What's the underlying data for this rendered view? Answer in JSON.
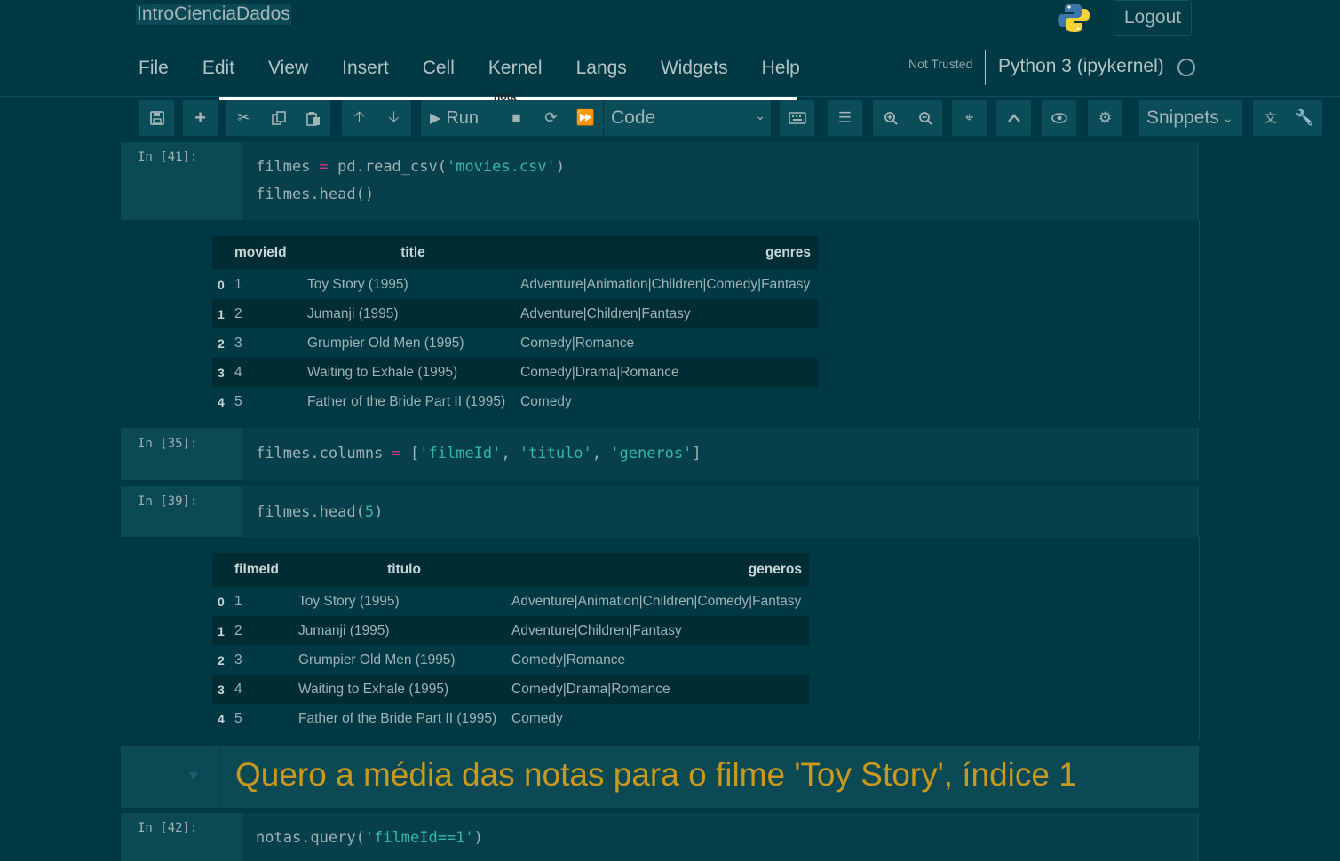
{
  "header": {
    "notebook_title": "IntroCienciaDados",
    "logout_label": "Logout",
    "trust_status": "Not Trusted",
    "kernel_name": "Python 3 (ipykernel)",
    "strip_text": "nota"
  },
  "menu": [
    "File",
    "Edit",
    "View",
    "Insert",
    "Cell",
    "Kernel",
    "Langs",
    "Widgets",
    "Help"
  ],
  "toolbar": {
    "run_label": "Run",
    "cell_type": "Code",
    "snippets_label": "Snippets"
  },
  "cells": [
    {
      "prompt": "In [41]:",
      "code_lines": [
        "filmes = pd.read_csv('movies.csv')",
        "filmes.head()"
      ],
      "output_table": {
        "columns": [
          "movieId",
          "title",
          "genres"
        ],
        "rows": [
          [
            "0",
            "1",
            "Toy Story (1995)",
            "Adventure|Animation|Children|Comedy|Fantasy"
          ],
          [
            "1",
            "2",
            "Jumanji (1995)",
            "Adventure|Children|Fantasy"
          ],
          [
            "2",
            "3",
            "Grumpier Old Men (1995)",
            "Comedy|Romance"
          ],
          [
            "3",
            "4",
            "Waiting to Exhale (1995)",
            "Comedy|Drama|Romance"
          ],
          [
            "4",
            "5",
            "Father of the Bride Part II (1995)",
            "Comedy"
          ]
        ]
      }
    },
    {
      "prompt": "In [35]:",
      "code_lines": [
        "filmes.columns = ['filmeId', 'titulo', 'generos']"
      ]
    },
    {
      "prompt": "In [39]:",
      "code_lines": [
        "filmes.head(5)"
      ],
      "output_table": {
        "columns": [
          "filmeId",
          "titulo",
          "generos"
        ],
        "rows": [
          [
            "0",
            "1",
            "Toy Story (1995)",
            "Adventure|Animation|Children|Comedy|Fantasy"
          ],
          [
            "1",
            "2",
            "Jumanji (1995)",
            "Adventure|Children|Fantasy"
          ],
          [
            "2",
            "3",
            "Grumpier Old Men (1995)",
            "Comedy|Romance"
          ],
          [
            "3",
            "4",
            "Waiting to Exhale (1995)",
            "Comedy|Drama|Romance"
          ],
          [
            "4",
            "5",
            "Father of the Bride Part II (1995)",
            "Comedy"
          ]
        ]
      }
    },
    {
      "markdown": "Quero a média das notas para o filme 'Toy Story', índice 1"
    },
    {
      "prompt": "In [42]:",
      "code_lines": [
        "notas.query('filmeId==1')"
      ]
    }
  ],
  "colors": {
    "background": "#003944",
    "markdown_heading": "#c8991d",
    "keyword": "#d33682",
    "string": "#36b5a7"
  }
}
